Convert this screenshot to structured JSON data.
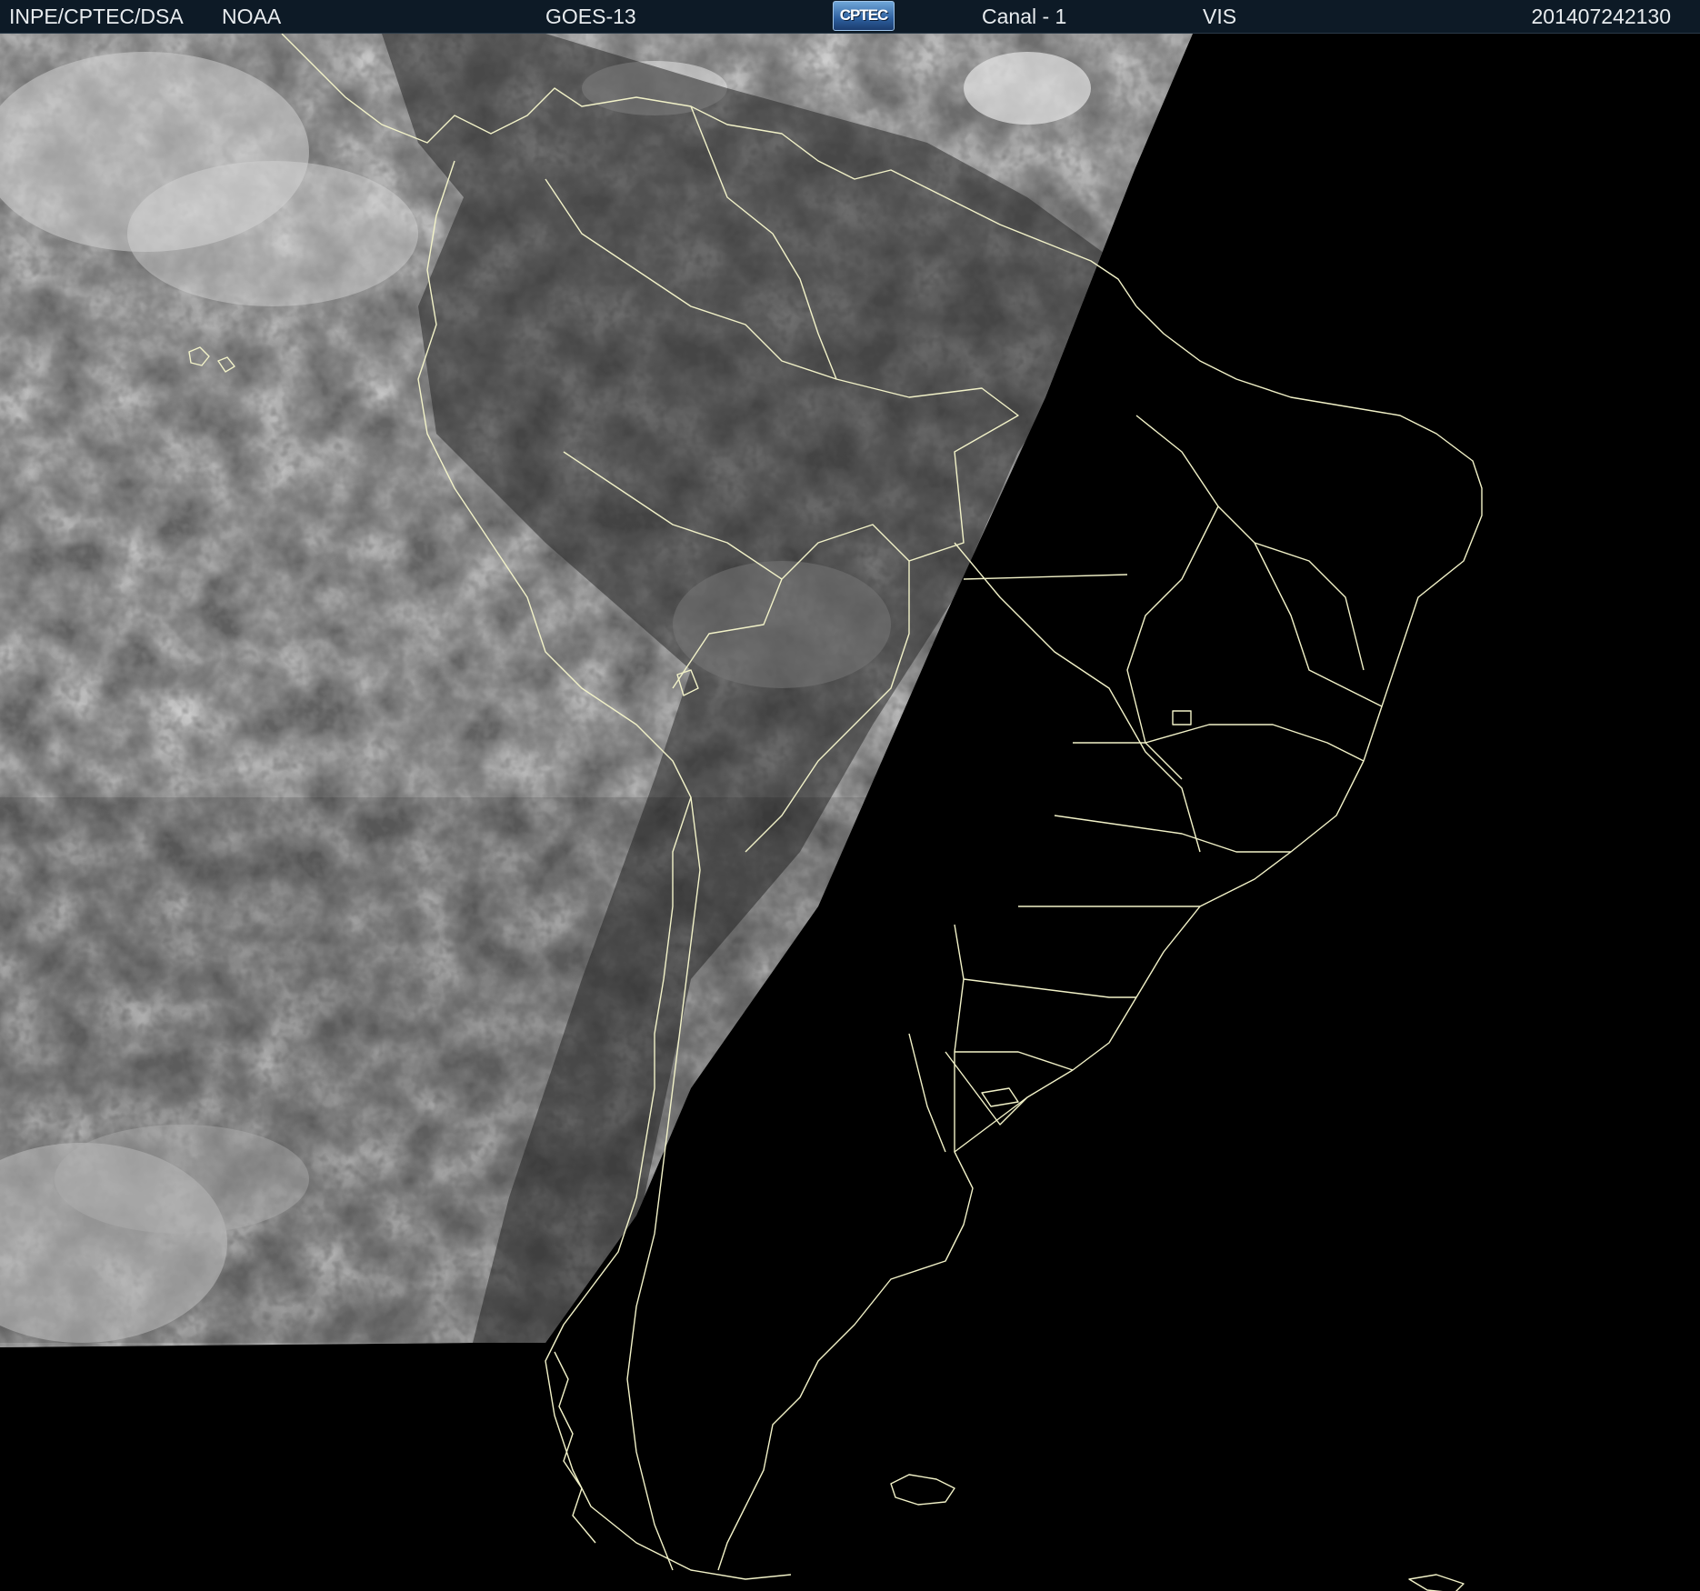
{
  "header": {
    "organization": "INPE/CPTEC/DSA",
    "agency": "NOAA",
    "satellite": "GOES-13",
    "logo_text": "CPTEC",
    "channel": "Canal - 1",
    "band": "VIS",
    "timestamp": "201407242130"
  },
  "colors": {
    "header_bg": "#0d1a26",
    "boundary_line": "#f2f2c8",
    "space_bg": "#000000"
  }
}
